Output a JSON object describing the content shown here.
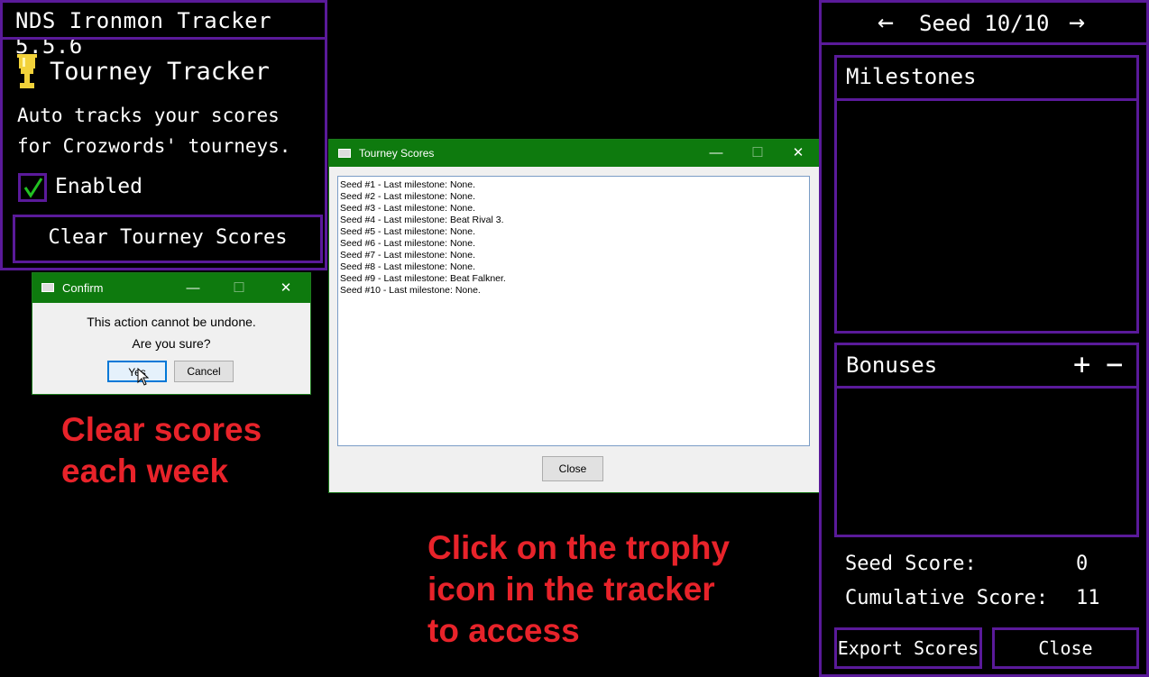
{
  "tracker": {
    "window_title": "NDS Ironmon Tracker 5.5.6",
    "panel_title": "Tourney Tracker",
    "description_line1": "Auto tracks your scores",
    "description_line2": "for Crozwords' tourneys.",
    "enabled_label": "Enabled",
    "enabled_checked": true,
    "clear_button_label": "Clear Tourney Scores",
    "icon": "trophy-icon"
  },
  "confirm_dialog": {
    "title": "Confirm",
    "message_line1": "This action cannot be undone.",
    "message_line2": "Are you sure?",
    "yes_label": "Yes",
    "cancel_label": "Cancel"
  },
  "scores_dialog": {
    "title": "Tourney Scores",
    "entries": [
      "Seed #1 - Last milestone: None.",
      "Seed #2 - Last milestone: None.",
      "Seed #3 - Last milestone: None.",
      "Seed #4 - Last milestone: Beat Rival 3.",
      "Seed #5 - Last milestone: None.",
      "Seed #6 - Last milestone: None.",
      "Seed #7 - Last milestone: None.",
      "Seed #8 - Last milestone: None.",
      "Seed #9 - Last milestone: Beat Falkner.",
      "Seed #10 - Last milestone: None."
    ],
    "close_label": "Close"
  },
  "window_controls": {
    "minimize": "—",
    "maximize": "☐",
    "close": "✕"
  },
  "annotations": {
    "left_line1": "Clear scores",
    "left_line2": "each week",
    "mid_line1": "Click on the trophy",
    "mid_line2": "icon in the tracker",
    "mid_line3": "to access"
  },
  "right_panel": {
    "arrow_left": "←",
    "arrow_right": "→",
    "seed_label": "Seed 10/10",
    "milestones_title": "Milestones",
    "bonuses_title": "Bonuses",
    "plus": "+",
    "minus": "−",
    "seed_score_label": "Seed Score:",
    "seed_score_value": "0",
    "cumulative_score_label": "Cumulative Score:",
    "cumulative_score_value": "11",
    "export_label": "Export Scores",
    "close_label": "Close"
  },
  "colors": {
    "border_purple": "#5a1a9a",
    "titlebar_green": "#0e7a0e",
    "annotation_red": "#e8232a",
    "check_green": "#22c222",
    "trophy_gold": "#f2d23a"
  }
}
